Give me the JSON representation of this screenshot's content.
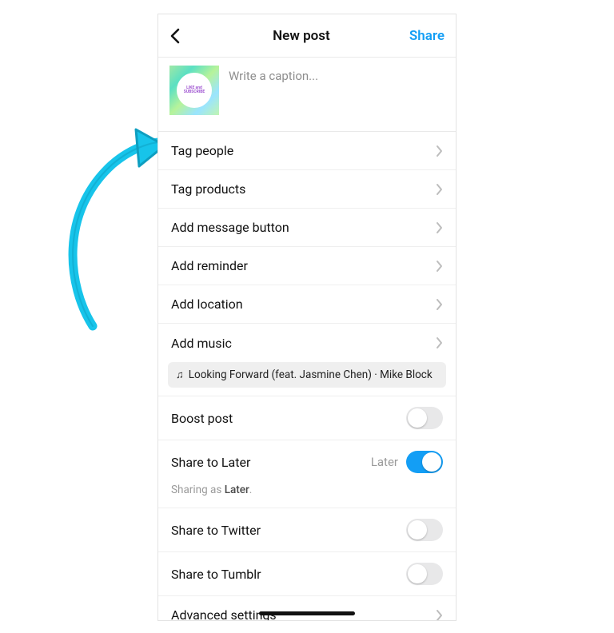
{
  "colors": {
    "accent": "#139ef5",
    "callout_arrow": "#17c4ea"
  },
  "header": {
    "title": "New post",
    "share_label": "Share"
  },
  "caption": {
    "placeholder": "Write a caption...",
    "thumb_text": "LIKE and SUBSCRIBE"
  },
  "rows": {
    "tag_people": "Tag people",
    "tag_products": "Tag products",
    "add_message_button": "Add message button",
    "add_reminder": "Add reminder",
    "add_location": "Add location",
    "add_music": "Add music",
    "boost_post": "Boost post",
    "share_to_later": "Share to Later",
    "share_to_twitter": "Share to Twitter",
    "share_to_tumblr": "Share to Tumblr",
    "advanced_settings": "Advanced settings"
  },
  "music_suggestion": "Looking Forward (feat. Jasmine Chen) · Mike Block",
  "share_later": {
    "right_label": "Later",
    "on": true,
    "sharing_as_prefix": "Sharing as ",
    "sharing_as_name": "Later",
    "sharing_as_suffix": "."
  },
  "toggles": {
    "boost_post": false,
    "twitter": false,
    "tumblr": false
  }
}
